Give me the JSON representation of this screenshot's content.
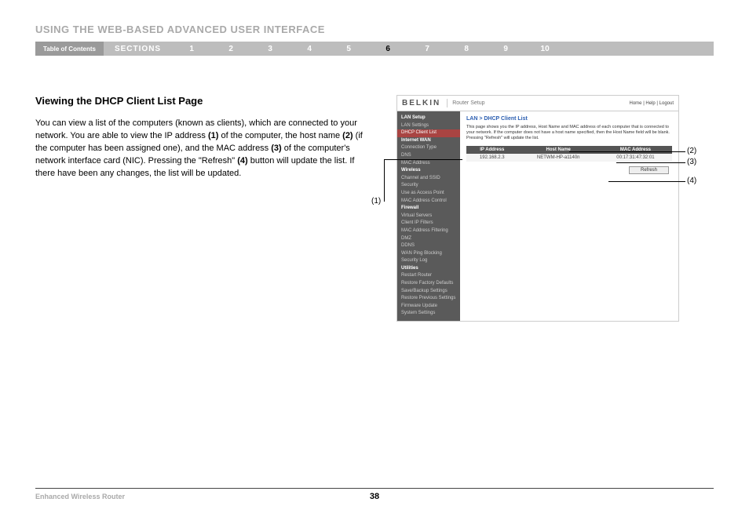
{
  "header": {
    "title": "USING THE WEB-BASED ADVANCED USER INTERFACE",
    "toc_label": "Table of Contents",
    "sections_label": "SECTIONS",
    "numbers": [
      "1",
      "2",
      "3",
      "4",
      "5",
      "6",
      "7",
      "8",
      "9",
      "10"
    ],
    "current": "6"
  },
  "article": {
    "heading": "Viewing the DHCP Client List Page",
    "paragraph_parts": [
      "You can view a list of the computers (known as clients), which are connected to your network. You are able to view the IP address ",
      "(1)",
      " of the computer, the host name ",
      "(2)",
      " (if the computer has been assigned one), and the MAC address ",
      "(3)",
      " of the computer's network interface card (NIC). Pressing the \"Refresh\" ",
      "(4)",
      " button will update the list. If there have been any changes, the list will be updated."
    ]
  },
  "router_ui": {
    "brand": "BELKIN",
    "title": "Router Setup",
    "top_links": "Home | Help | Logout",
    "sidebar": [
      {
        "t": "LAN Setup",
        "cls": "hd"
      },
      {
        "t": "LAN Settings",
        "cls": ""
      },
      {
        "t": "DHCP Client List",
        "cls": "hl"
      },
      {
        "t": "Internet WAN",
        "cls": "hd"
      },
      {
        "t": "Connection Type",
        "cls": ""
      },
      {
        "t": "DNS",
        "cls": ""
      },
      {
        "t": "MAC Address",
        "cls": ""
      },
      {
        "t": "Wireless",
        "cls": "hd"
      },
      {
        "t": "Channel and SSID",
        "cls": ""
      },
      {
        "t": "Security",
        "cls": ""
      },
      {
        "t": "Use as Access Point",
        "cls": ""
      },
      {
        "t": "MAC Address Control",
        "cls": ""
      },
      {
        "t": "Firewall",
        "cls": "hd"
      },
      {
        "t": "Virtual Servers",
        "cls": ""
      },
      {
        "t": "Client IP Filters",
        "cls": ""
      },
      {
        "t": "MAC Address Filtering",
        "cls": ""
      },
      {
        "t": "DMZ",
        "cls": ""
      },
      {
        "t": "DDNS",
        "cls": ""
      },
      {
        "t": "WAN Ping Blocking",
        "cls": ""
      },
      {
        "t": "Security Log",
        "cls": ""
      },
      {
        "t": "Utilities",
        "cls": "hd"
      },
      {
        "t": "Restart Router",
        "cls": ""
      },
      {
        "t": "Restore Factory Defaults",
        "cls": ""
      },
      {
        "t": "Save/Backup Settings",
        "cls": ""
      },
      {
        "t": "Restore Previous Settings",
        "cls": ""
      },
      {
        "t": "Firmware Update",
        "cls": ""
      },
      {
        "t": "System Settings",
        "cls": ""
      }
    ],
    "breadcrumb": "LAN > DHCP Client List",
    "description": "This page shows you the IP address, Host Name and MAC address of each computer that is connected to your network. If the computer does not have a host name specified, then the Host Name field will be blank. Pressing \"Refresh\" will update the list.",
    "table": {
      "headers": [
        "IP Address",
        "Host Name",
        "MAC Address"
      ],
      "row": [
        "192.168.2.3",
        "NETWM-HP-a1140n",
        "00:17:31:47:32:01"
      ]
    },
    "refresh_label": "Refresh"
  },
  "callouts": {
    "c1": "(1)",
    "c2": "(2)",
    "c3": "(3)",
    "c4": "(4)"
  },
  "footer": {
    "product": "Enhanced Wireless Router",
    "page": "38"
  }
}
